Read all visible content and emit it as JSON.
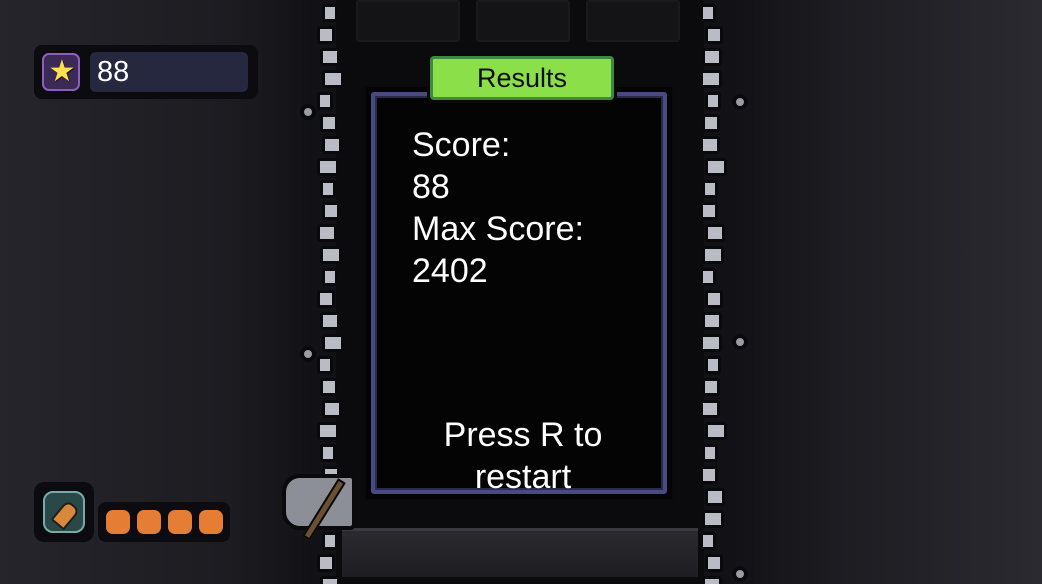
{
  "hud": {
    "score_value": "88",
    "score_icon": "star-icon",
    "ammo_icon": "bullet-icon",
    "ammo_count": 4,
    "ammo_color": "#e57e34"
  },
  "results": {
    "title": "Results",
    "score_label": "Score:",
    "score_value": "88",
    "max_score_label": "Max Score:",
    "max_score_value": "2402",
    "restart_line1": "Press R to",
    "restart_line2": "restart"
  },
  "colors": {
    "header_green": "#8be04a",
    "panel_border": "#4a4a82",
    "wall_stone": "#b9bcc4"
  }
}
